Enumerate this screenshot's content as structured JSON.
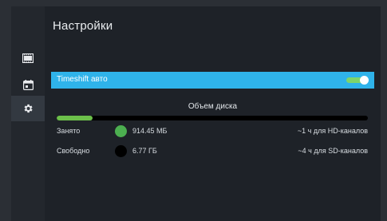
{
  "title": "Настройки",
  "sidebar": {
    "items": [
      {
        "icon": "film-icon",
        "active": false
      },
      {
        "icon": "calendar-icon",
        "active": false
      },
      {
        "icon": "gear-icon",
        "active": true
      }
    ]
  },
  "timeshift": {
    "label": "Timeshift авто",
    "enabled": true,
    "colors": {
      "row": "#2fb3ea",
      "track": "#7ed46a"
    }
  },
  "disk": {
    "title": "Объем диска",
    "used_fraction": 0.115,
    "rows": [
      {
        "label": "Занято",
        "value": "914.45 МБ",
        "note": "~1 ч для HD-каналов",
        "color": "#4caf50"
      },
      {
        "label": "Свободно",
        "value": "6.77 ГБ",
        "note": "~4 ч для SD-каналов",
        "color": "#000000"
      }
    ]
  }
}
